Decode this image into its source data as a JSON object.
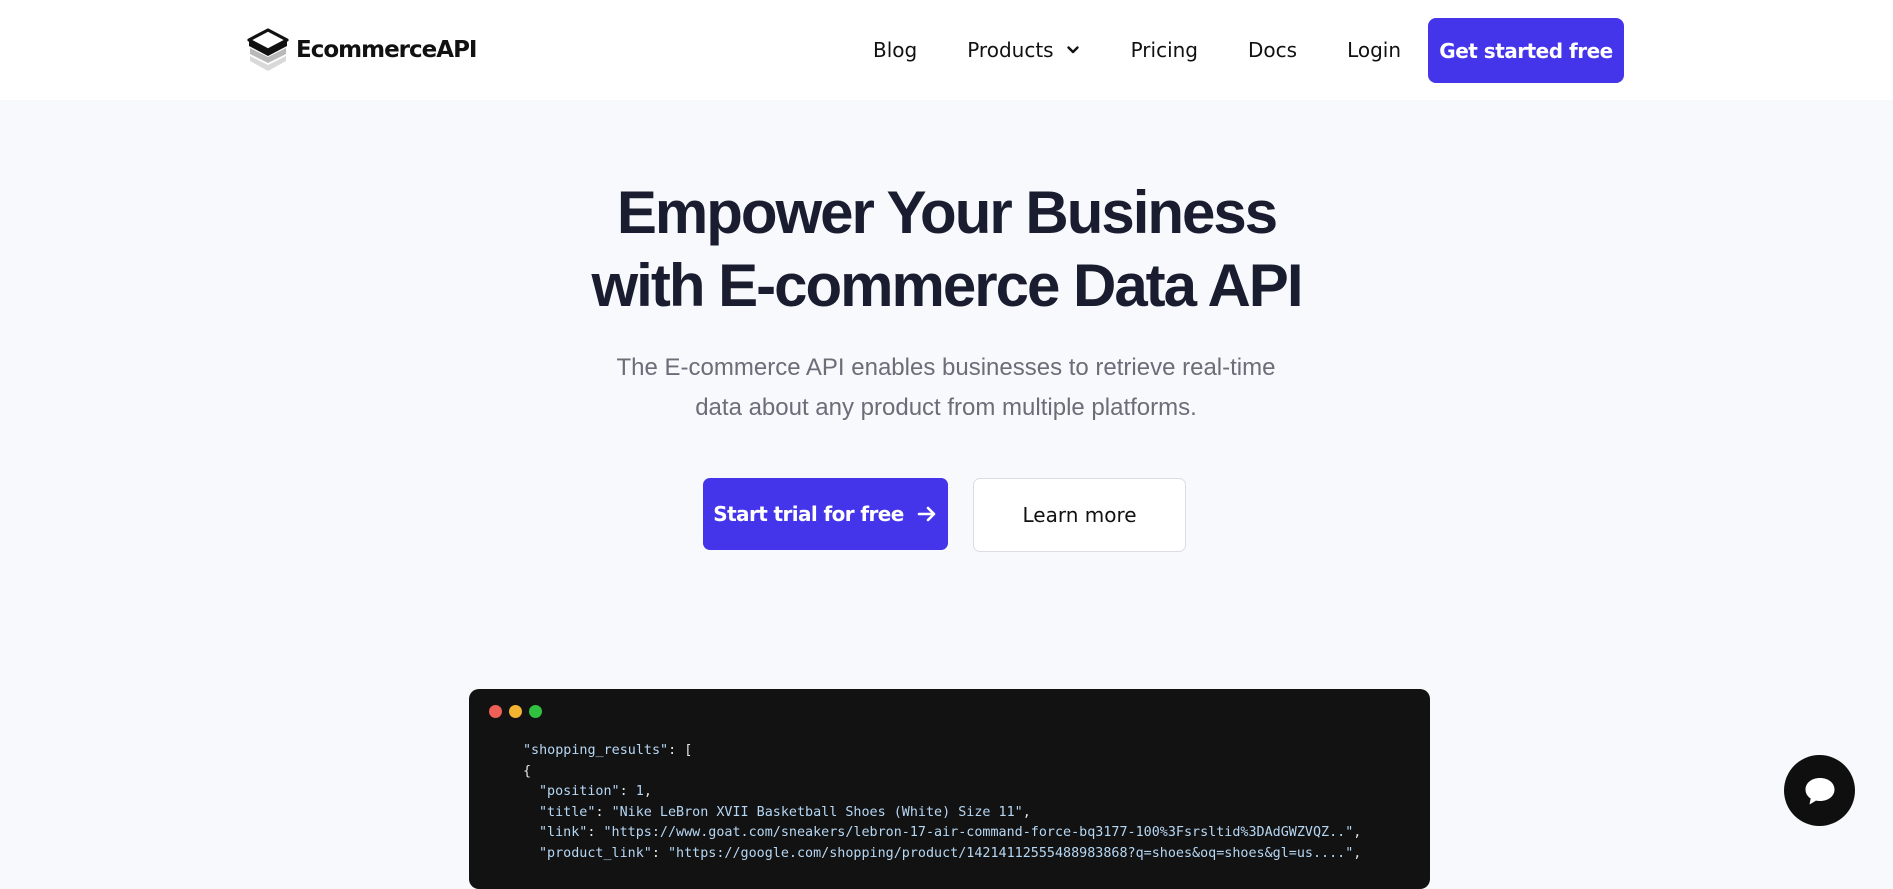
{
  "brand": {
    "name_part1": "Ecommerce",
    "name_part2": "API",
    "logo_icon": "stacked-layers-icon"
  },
  "nav": {
    "blog": "Blog",
    "products": "Products",
    "pricing": "Pricing",
    "docs": "Docs",
    "login": "Login",
    "cta": "Get started free"
  },
  "hero": {
    "title_line1": "Empower Your Business",
    "title_line2": "with E-commerce Data API",
    "subtitle_line1": "The E-commerce API enables businesses to retrieve real-time",
    "subtitle_line2": "data about any product from multiple platforms.",
    "primary_button": "Start trial for free",
    "secondary_button": "Learn more"
  },
  "code_window": {
    "dots": [
      "#ed5f57",
      "#f2b431",
      "#2fc13f"
    ],
    "lines": [
      {
        "indent": 0,
        "key": "\"shopping_results\"",
        "sep": ": ",
        "value": "[",
        "vtype": "p"
      },
      {
        "indent": 0,
        "key": "",
        "sep": "",
        "value": "{",
        "vtype": "p"
      },
      {
        "indent": 1,
        "key": "\"position\"",
        "sep": ": ",
        "value": "1",
        "vtype": "n",
        "tail": ","
      },
      {
        "indent": 1,
        "key": "\"title\"",
        "sep": ": ",
        "value": "\"Nike LeBron XVII Basketball Shoes (White) Size 11\"",
        "vtype": "s",
        "tail": ","
      },
      {
        "indent": 1,
        "key": "\"link\"",
        "sep": ": ",
        "value": "\"https://www.goat.com/sneakers/lebron-17-air-command-force-bq3177-100%3Fsrsltid%3DAdGWZVQZ..\"",
        "vtype": "s",
        "tail": ","
      },
      {
        "indent": 1,
        "key": "\"product_link\"",
        "sep": ": ",
        "value": "\"https://google.com/shopping/product/14214112555488983868?q=shoes&oq=shoes&gl=us....\"",
        "vtype": "s",
        "tail": ","
      }
    ]
  },
  "chat": {
    "icon": "chat-bubble-icon"
  },
  "colors": {
    "accent": "#4535ea",
    "title": "#1a1d30",
    "subtitle": "#6b6d78",
    "code_bg": "#121212"
  }
}
